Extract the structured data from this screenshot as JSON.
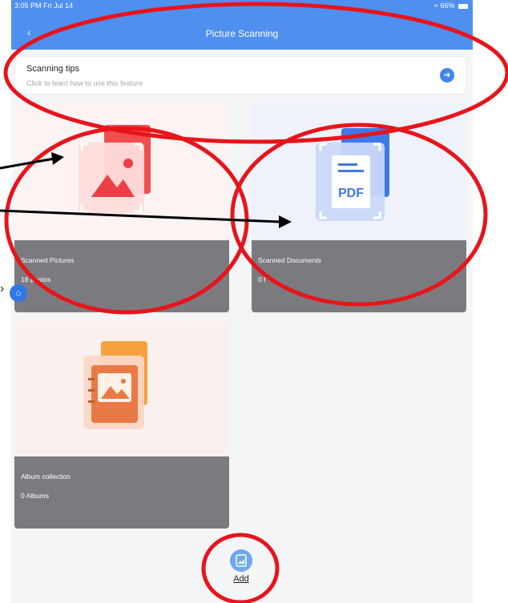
{
  "status_bar": {
    "time": "3:05 PM  Fri Jul 14",
    "battery": "66%"
  },
  "header": {
    "title": "Picture Scanning",
    "back_icon": "chevron-left-icon"
  },
  "tips": {
    "title": "Scanning tips",
    "subtitle": "Click to learn how to use this feature",
    "icon": "arrow-right-circle-icon"
  },
  "cards": [
    {
      "name": "Scanned Pictures",
      "count": "18 photos",
      "icon": "picture-scan-icon",
      "accent": "#ee4d4d"
    },
    {
      "name": "Scanned Documents",
      "count": "0 f",
      "icon": "pdf-document-icon",
      "pdf_label": "PDF",
      "accent": "#3d78e6"
    },
    {
      "name": "Album collection",
      "count": "0 Albums",
      "icon": "album-book-icon",
      "accent": "#f08a3c"
    }
  ],
  "floating": {
    "home_icon": "home-icon",
    "chevron_icon": "chevron-right-icon"
  },
  "add_button": {
    "label": "Add",
    "icon": "scan-add-icon"
  },
  "annotations": {
    "color": "#e8141b"
  }
}
